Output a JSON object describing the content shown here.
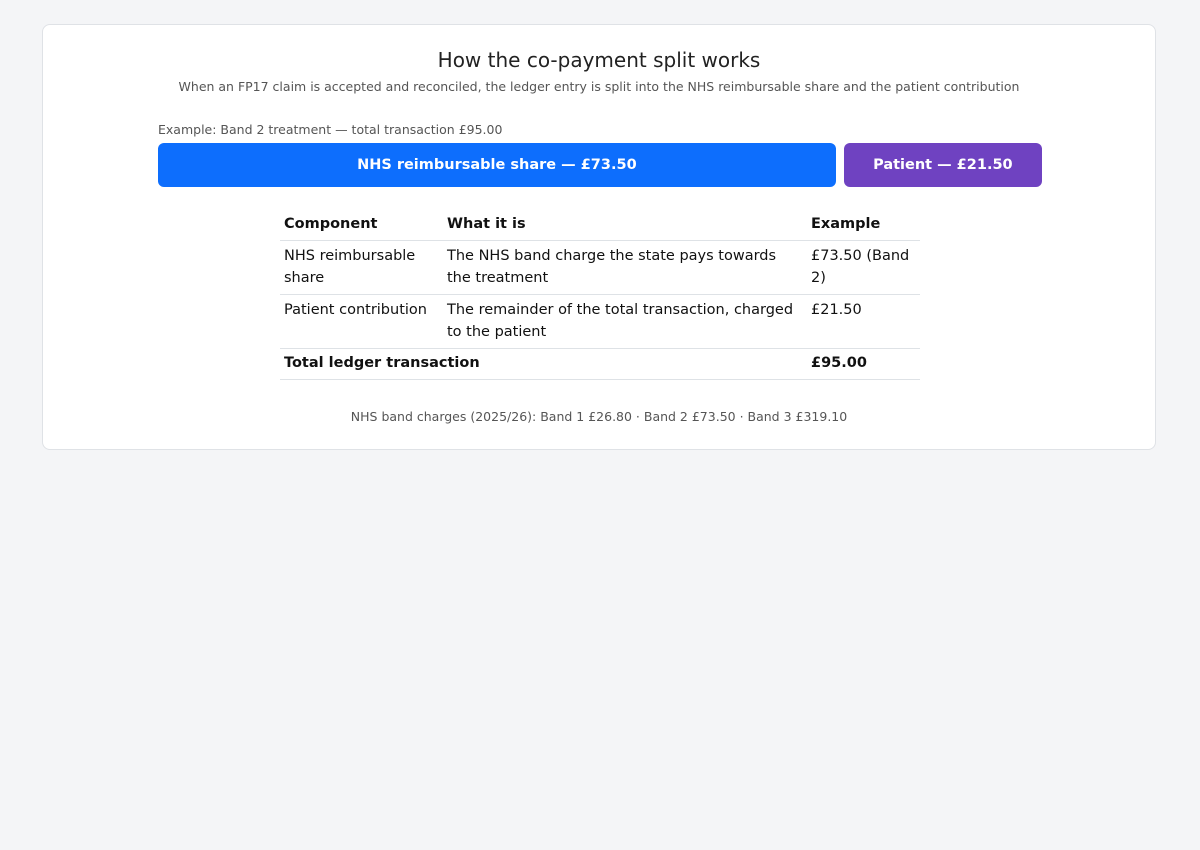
{
  "page": {
    "title": "How the co-payment split works",
    "subtitle": "When an FP17 claim is accepted and reconciled, the ledger entry is split into the NHS reimbursable share and the patient contribution",
    "colors": {
      "background": "#f4f5f7",
      "nhs_share": "#0d6efd",
      "patient_share": "#6f42c1"
    }
  },
  "split_bar": {
    "caption": "Example: Band 2 treatment — total transaction £95.00",
    "total": 95.0,
    "segments": [
      {
        "label": "NHS reimbursable share — £73.50",
        "amount": 73.5
      },
      {
        "label": "Patient — £21.50",
        "amount": 21.5
      }
    ]
  },
  "table": {
    "headers": [
      "Component",
      "What it is",
      "Example"
    ],
    "rows": [
      [
        "NHS reimbursable share",
        "The NHS band charge the state pays towards the treatment",
        "£73.50 (Band 2)"
      ],
      [
        "Patient contribution",
        "The remainder of the total transaction, charged to the patient",
        "£21.50"
      ]
    ],
    "total_row": {
      "label": "Total ledger transaction",
      "value": "£95.00"
    }
  },
  "footnote": "NHS band charges (2025/26): Band 1 £26.80 · Band 2 £73.50 · Band 3 £319.10"
}
